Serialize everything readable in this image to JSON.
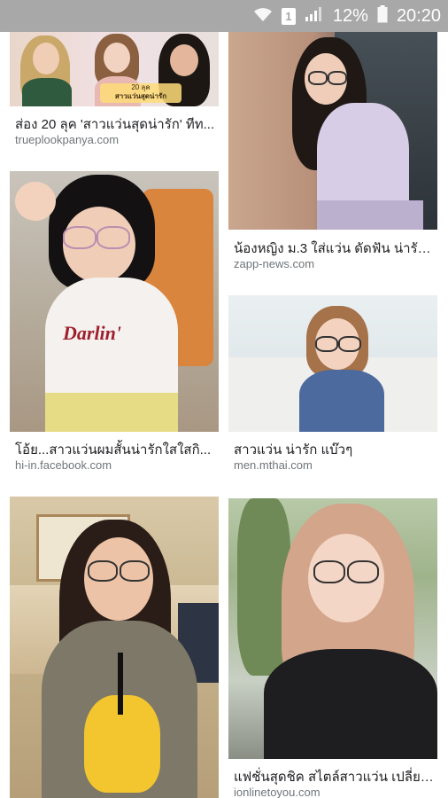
{
  "status_bar": {
    "battery": "12%",
    "time": "20:20",
    "sim_label": "1"
  },
  "results": [
    {
      "caption": "ส่อง 20 ลุค 'สาวแว่นสุดน่ารัก' ทีท...",
      "source": "trueplookpanya.com",
      "overlay_line1": "20 ลุค",
      "overlay_line2": "สาวแว่นสุดน่ารัก"
    },
    {
      "caption": "น้องหญิง ม.3 ใส่แว่น ดัดฟัน น่ารัก...",
      "source": "zapp-news.com"
    },
    {
      "caption": "โอ้ย...สาวแว่นผมสั้นน่ารักใสใสกิ...",
      "source": "hi-in.facebook.com",
      "shirt_text": "Darlin'"
    },
    {
      "caption": "สาวแว่น น่ารัก แบ๊วๆ",
      "source": "men.mthai.com"
    },
    {
      "caption": "",
      "source": ""
    },
    {
      "caption": "แฟชั่นสุดชิค สไตล์สาวแว่น เปลี่ยน...",
      "source": "ionlinetoyou.com"
    }
  ]
}
